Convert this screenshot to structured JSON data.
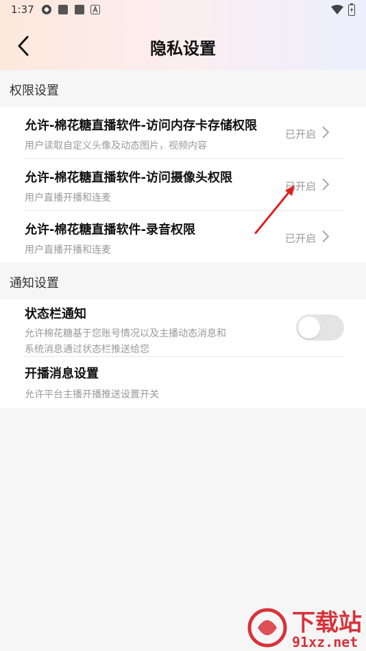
{
  "status_bar": {
    "time": "1:37"
  },
  "header": {
    "title": "隐私设置"
  },
  "permissions": {
    "section_label": "权限设置",
    "items": [
      {
        "title": "允许-棉花糖直播软件-访问内存卡存储权限",
        "subtitle": "用户读取自定义头像及动态图片，视频内容",
        "status": "已开启"
      },
      {
        "title": "允许-棉花糖直播软件-访问摄像头权限",
        "subtitle": "用户直播开播和连麦",
        "status": "已开启"
      },
      {
        "title": "允许-棉花糖直播软件-录音权限",
        "subtitle": "用户直播开播和连麦",
        "status": "已开启"
      }
    ]
  },
  "notifications": {
    "section_label": "通知设置",
    "items": [
      {
        "title": "状态栏通知",
        "subtitle_line1": "允许棉花糖基于您账号情况以及主播动态消息和",
        "subtitle_line2": "系统消息通过状态栏推送给您",
        "toggle_on": false
      },
      {
        "title": "开播消息设置",
        "subtitle": "允许平台主播开播推送设置开关"
      }
    ]
  },
  "watermark": {
    "text": "下载站",
    "url": "91xz.net"
  },
  "colors": {
    "annotation_arrow": "#e02020",
    "watermark": "#d8323a"
  }
}
